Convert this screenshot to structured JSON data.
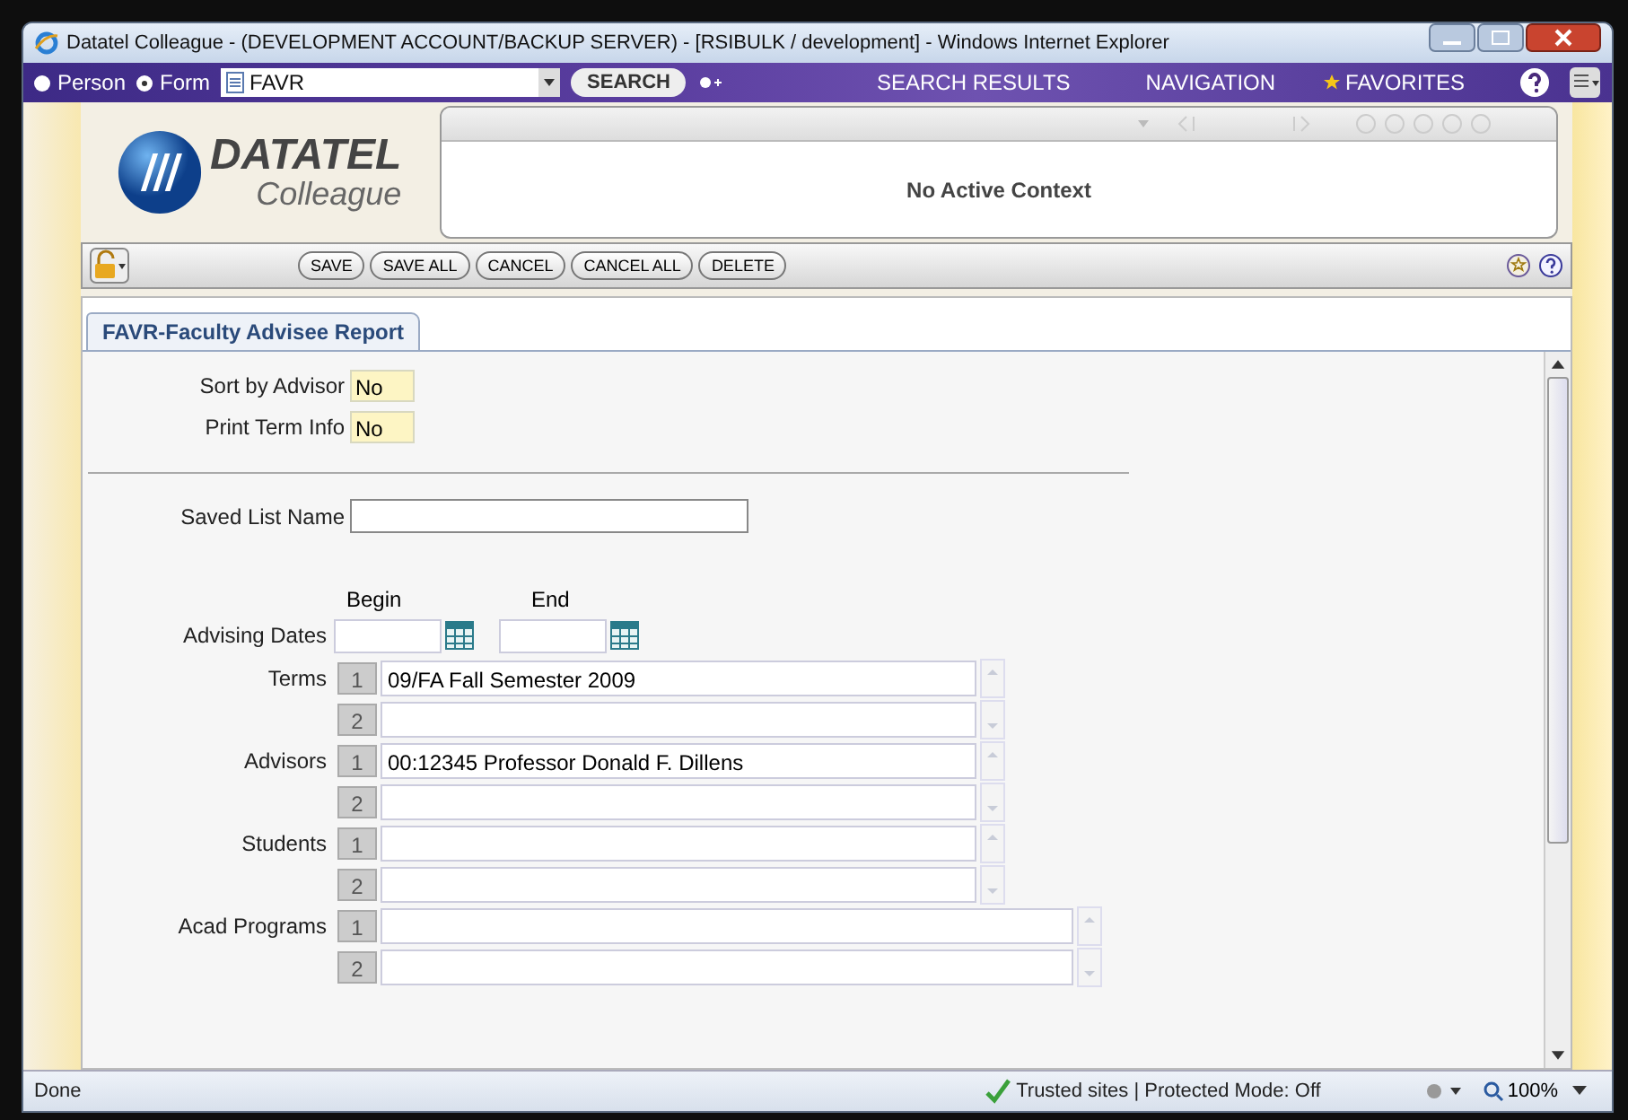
{
  "window": {
    "title": "Datatel Colleague - (DEVELOPMENT ACCOUNT/BACKUP SERVER) - [RSIBULK / development] - Windows Internet Explorer"
  },
  "nav": {
    "modes": [
      {
        "label": "Person",
        "selected": false
      },
      {
        "label": "Form",
        "selected": true
      }
    ],
    "form_value": "FAVR",
    "search_button": "SEARCH",
    "links": [
      "SEARCH RESULTS",
      "NAVIGATION"
    ],
    "favorites": "FAVORITES"
  },
  "logo": {
    "brand": "DATATEL",
    "product": "Colleague"
  },
  "context": {
    "message": "No Active Context"
  },
  "toolbar": {
    "buttons": [
      "SAVE",
      "SAVE ALL",
      "CANCEL",
      "CANCEL ALL",
      "DELETE"
    ]
  },
  "form": {
    "tab": "FAVR-Faculty Advisee Report",
    "flags": [
      {
        "label": "Sort by Advisor",
        "value": "No"
      },
      {
        "label": "Print Term Info",
        "value": "No"
      }
    ],
    "saved_list": {
      "label": "Saved List Name"
    },
    "dates": {
      "label": "Advising Dates",
      "begin": "Begin",
      "end": "End"
    },
    "lists": [
      {
        "label": "Terms",
        "wide": false,
        "rows": [
          {
            "index": "1",
            "value": "09/FA Fall Semester 2009"
          },
          {
            "index": "2"
          }
        ]
      },
      {
        "label": "Advisors",
        "wide": false,
        "rows": [
          {
            "index": "1",
            "value": "00:12345 Professor Donald F. Dillens"
          },
          {
            "index": "2"
          }
        ]
      },
      {
        "label": "Students",
        "wide": false,
        "rows": [
          {
            "index": "1"
          },
          {
            "index": "2"
          }
        ]
      },
      {
        "label": "Acad Programs",
        "wide": true,
        "rows": [
          {
            "index": "1"
          },
          {
            "index": "2"
          }
        ]
      }
    ]
  },
  "status_bar": {
    "text": "Done",
    "zone": "Trusted sites | Protected Mode: Off",
    "zoom": "100%"
  }
}
